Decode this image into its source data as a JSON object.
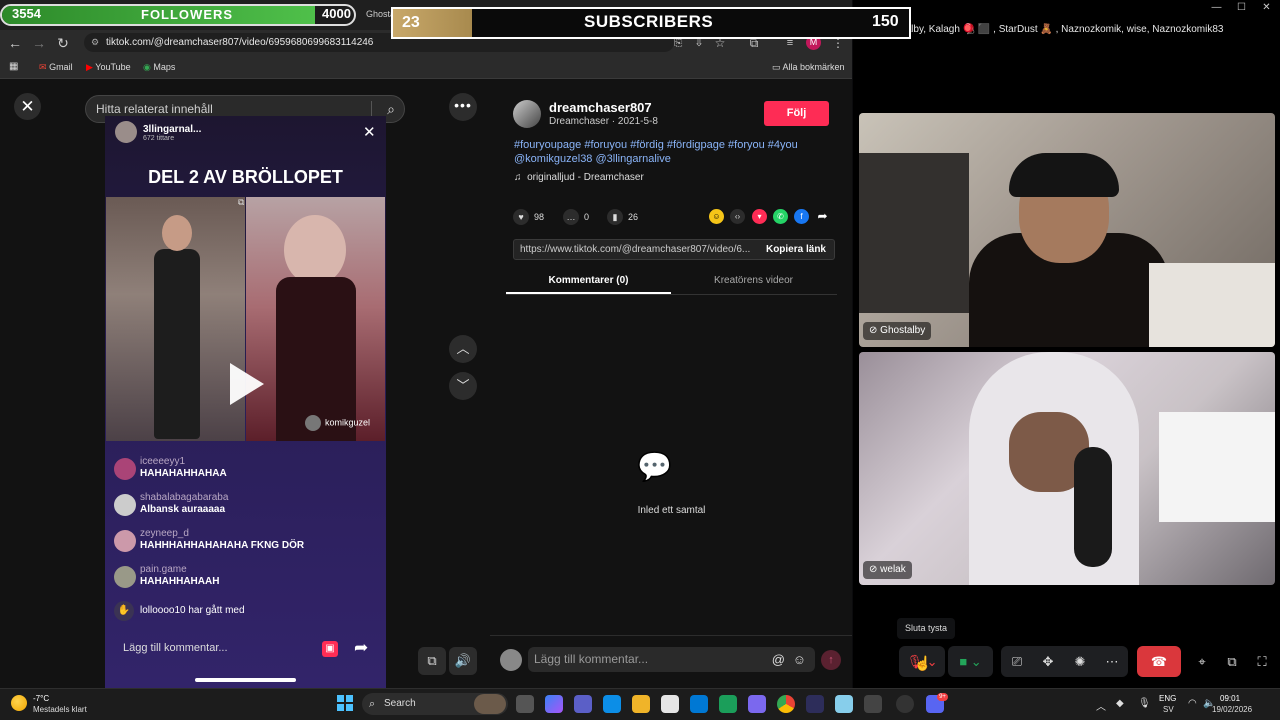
{
  "overlays": {
    "followers": {
      "count": "3554",
      "label": "FOLLOWERS",
      "goal": "4000",
      "progress": 0.8885,
      "fill_color": "#3fae3a"
    },
    "subscribers": {
      "count": "23",
      "label": "SUBSCRIBERS",
      "goal": "150",
      "progress": 0.1533,
      "fill_color": "#c8a86a"
    }
  },
  "browser": {
    "tab_partial": "Ghosta",
    "new_tab": "+",
    "url": "tiktok.com/@dreamchaser807/video/6959680699683114246",
    "bookmarks": [
      {
        "label": "Gmail",
        "icon": "gmail-icon",
        "color": "#ea4335"
      },
      {
        "label": "YouTube",
        "icon": "youtube-icon",
        "color": "#ff0000"
      },
      {
        "label": "Maps",
        "icon": "maps-icon",
        "color": "#34a853"
      }
    ],
    "all_bookmarks": "Alla bokmärken",
    "profile_initial": "M"
  },
  "tiktok": {
    "search_placeholder": "Hitta relaterat innehåll",
    "video": {
      "host": "3llingarnal...",
      "viewers": "672 tittare",
      "title": "DEL 2 AV BRÖLLOPET",
      "clip_user": "komikguzel",
      "chat": [
        {
          "user": "iceeeeyy1",
          "message": "HAHAHAHHAHAA"
        },
        {
          "user": "shabalabagabaraba",
          "message": "Albansk auraaaaa"
        },
        {
          "user": "zeyneep_d",
          "message": "HAHHHAHHAHAHAHA FKNG DÖR"
        },
        {
          "user": "pain.game",
          "message": "HAHAHHAHAAH"
        }
      ],
      "join_text": "lolloooo10 har gått med",
      "comment_placeholder": "Lägg till kommentar..."
    },
    "author": {
      "username": "dreamchaser807",
      "subline": "Dreamchaser · 2021-5-8",
      "follow_label": "Följ"
    },
    "hashtags": "#fouryoupage #foruyou #fördig #fördigpage #foryou #4you @komikguzel38 @3llingarnalive",
    "sound": "originalljud - Dreamchaser",
    "stats": {
      "likes": "98",
      "comments": "0",
      "saves": "26"
    },
    "link_text": "https://www.tiktok.com/@dreamchaser807/video/6...",
    "copy_link": "Kopiera länk",
    "tabs": [
      "Kommentarer (0)",
      "Kreatörens videor"
    ],
    "empty_text": "Inled ett samtal",
    "comment_input_placeholder": "Lägg till kommentar...",
    "accent": "#fe2c55"
  },
  "call": {
    "participants_line": "@  Ghostalby, Kalagh 🪀 ⬛ , StarDust 🧸 , Naznozkomik, wise, Naznozkomik83",
    "cams": [
      {
        "name": "Ghostalby"
      },
      {
        "name": "welak"
      }
    ],
    "tooltip": "Sluta tysta",
    "hangup_color": "#da373c"
  },
  "taskbar": {
    "temp": "-7°C",
    "weather": "Mestadels klart",
    "search": "Search",
    "lang1": "ENG",
    "lang2": "SV",
    "time": "09:01",
    "date": "19/02/2026",
    "discord_badge": "9+"
  }
}
